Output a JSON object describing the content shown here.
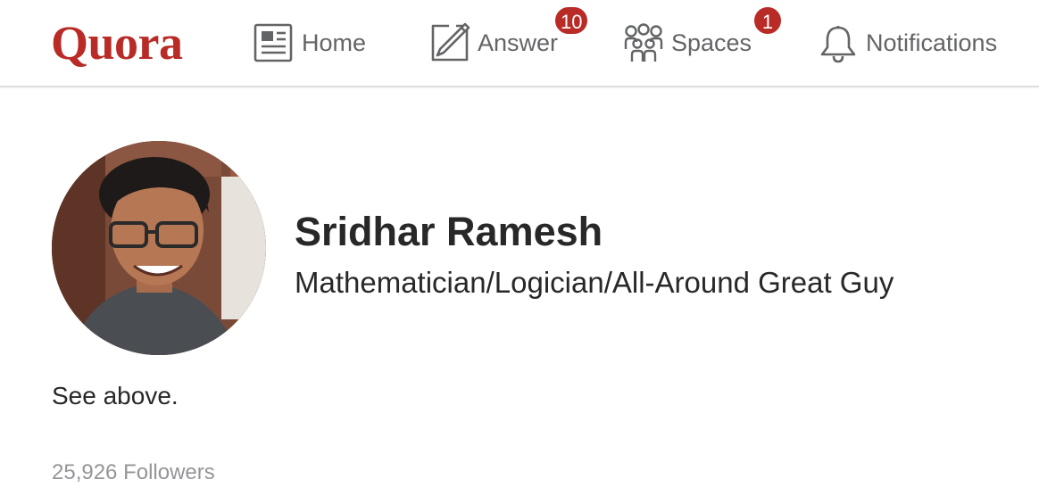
{
  "header": {
    "logo": "Quora",
    "brand_color": "#b92b27",
    "nav": {
      "home": {
        "label": "Home",
        "icon": "news-feed-icon"
      },
      "answer": {
        "label": "Answer",
        "icon": "pencil-square-icon",
        "badge": "10"
      },
      "spaces": {
        "label": "Spaces",
        "icon": "people-group-icon",
        "badge": "1"
      },
      "notifications": {
        "label": "Notifications",
        "icon": "bell-icon"
      }
    }
  },
  "profile": {
    "avatar": "profile-photo",
    "name": "Sridhar Ramesh",
    "tagline": "Mathematician/Logician/All-Around Great Guy",
    "bio": "See above.",
    "followers": "25,926 Followers"
  }
}
